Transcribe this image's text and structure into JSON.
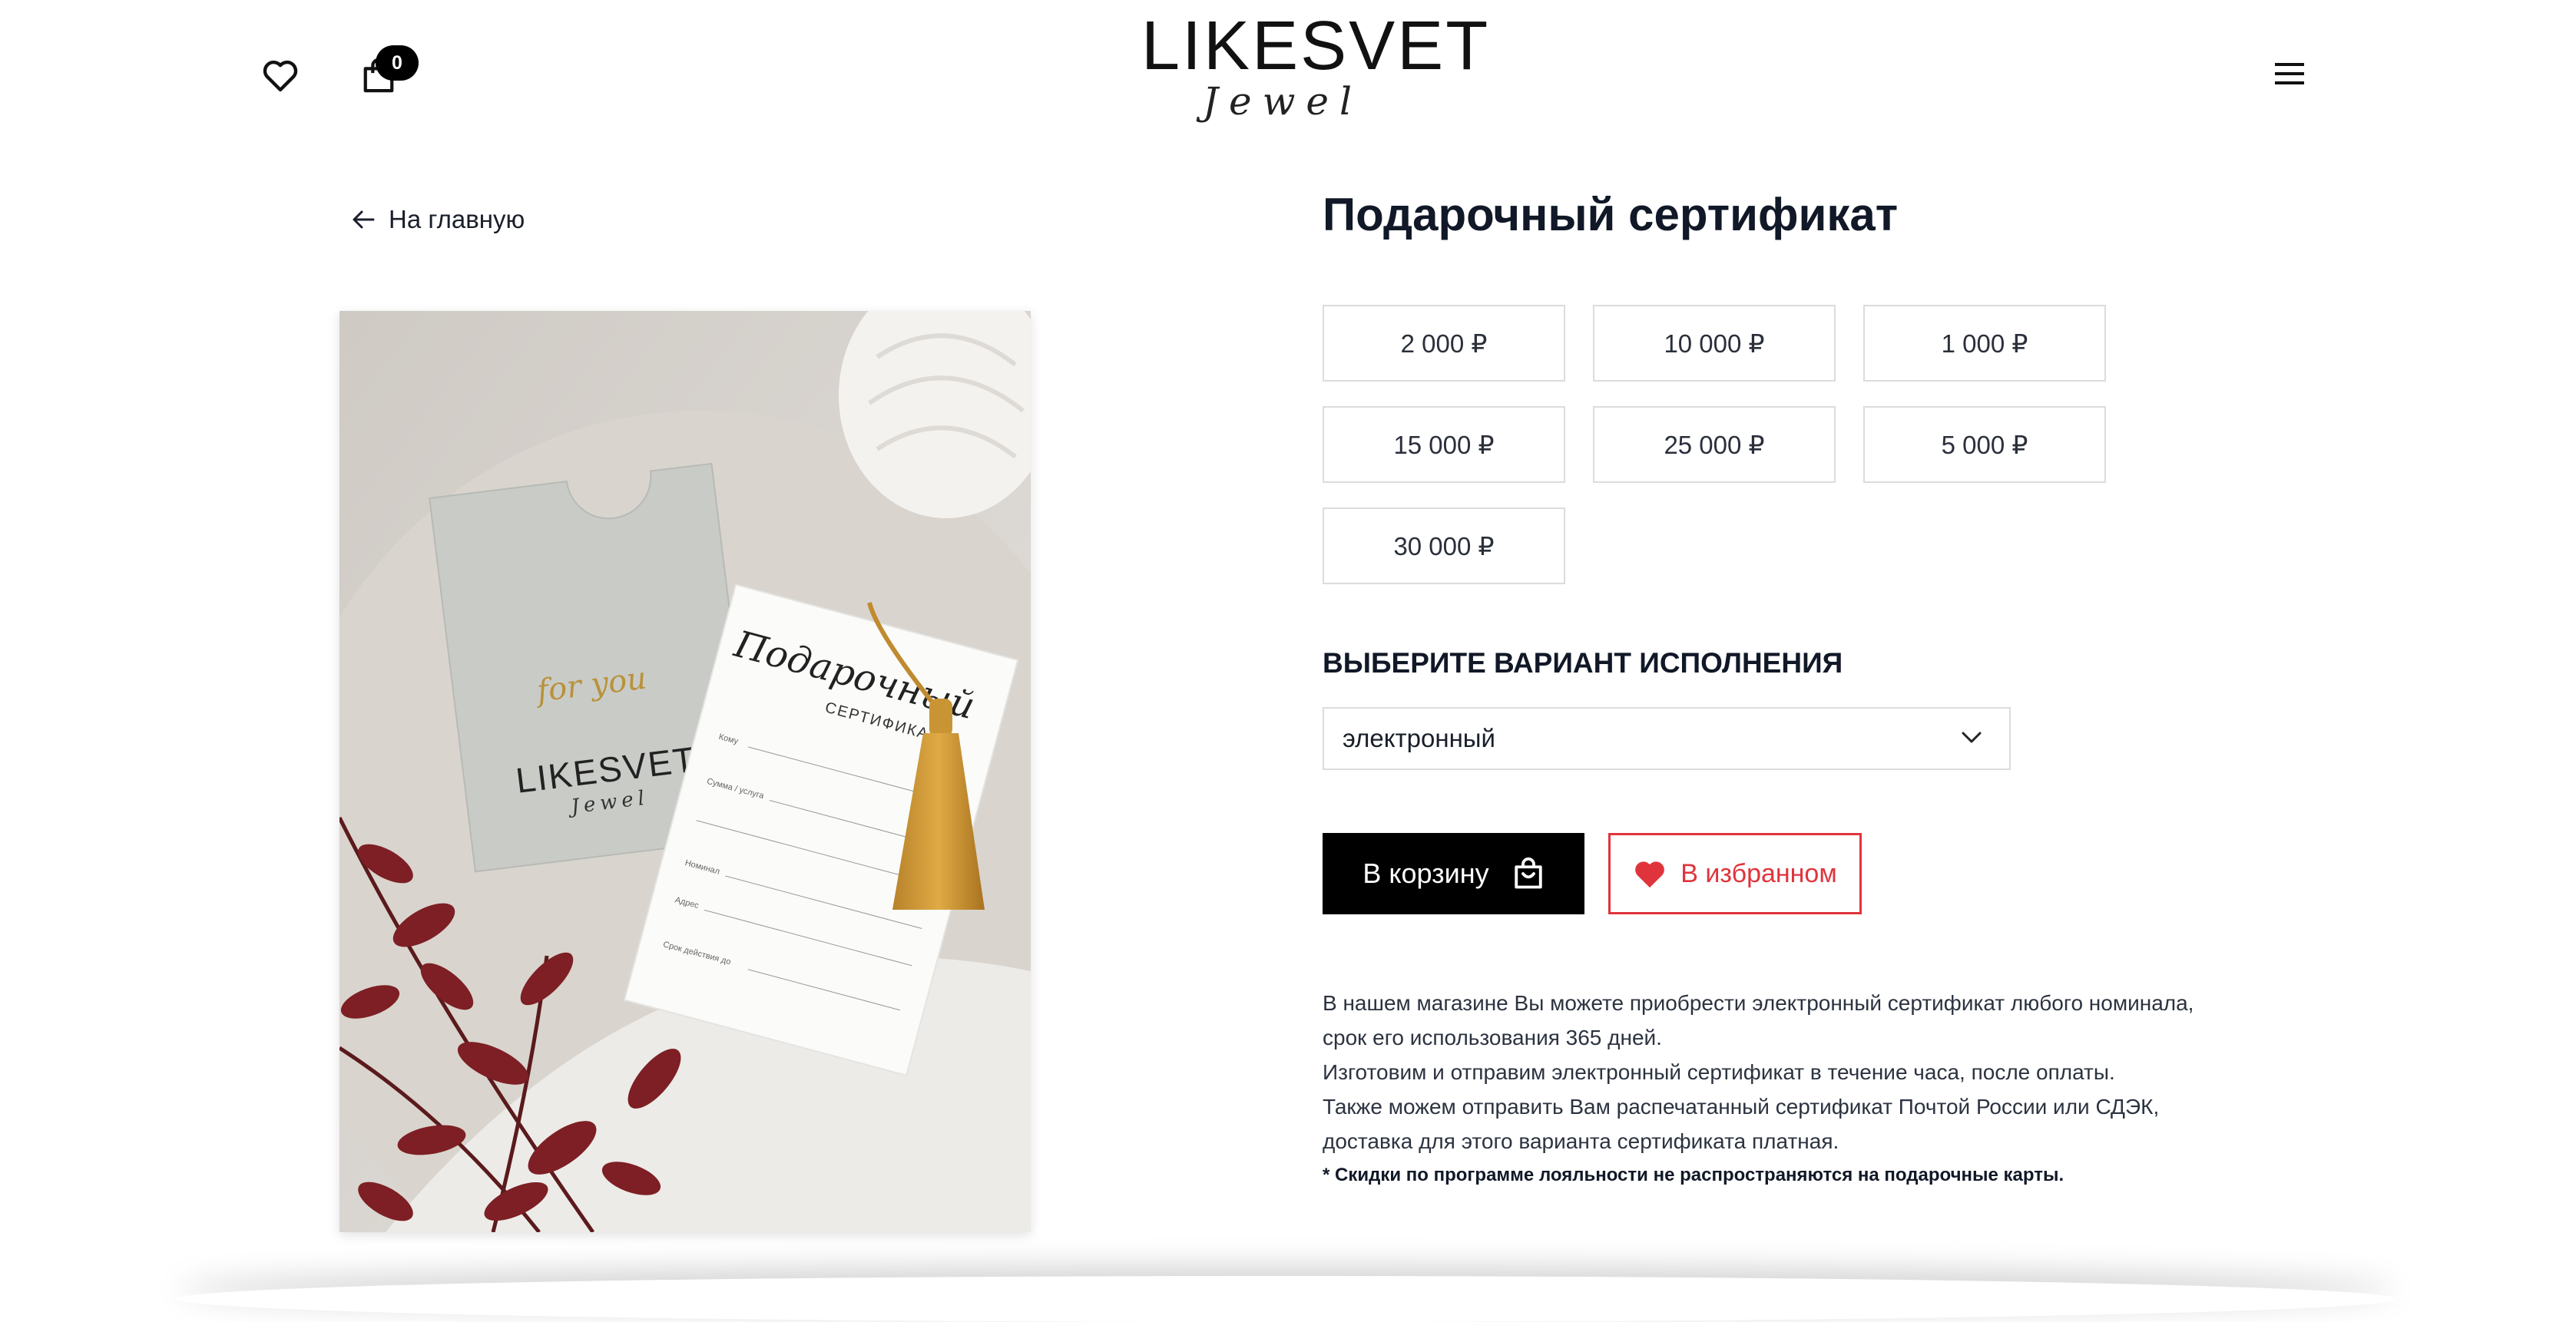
{
  "header": {
    "cart_count": "0",
    "logo_main": "LIKESVET",
    "logo_sub": "Jewel"
  },
  "nav": {
    "back_label": "На главную"
  },
  "product": {
    "title": "Подарочный сертификат",
    "amounts": [
      "2 000 ₽",
      "10 000 ₽",
      "1 000 ₽",
      "15 000 ₽",
      "25 000 ₽",
      "5 000 ₽",
      "30 000 ₽"
    ],
    "variant_label": "ВЫБЕРИТЕ ВАРИАНТ ИСПОЛНЕНИЯ",
    "variant_value": "электронный",
    "cart_button": "В корзину",
    "favorite_button": "В избранном",
    "description": [
      "В нашем магазине Вы можете приобрести электронный сертификат любого номинала,",
      "срок его использования 365 дней.",
      "Изготовим и отправим электронный сертификат в течение часа, после оплаты.",
      "Также можем отправить Вам распечатанный сертификат Почтой России или СДЭК,",
      "доставка для этого варианта сертификата платная."
    ],
    "note": "* Скидки по программе лояльности не распространяются на подарочные карты."
  },
  "photo": {
    "envelope_script": "for you",
    "envelope_logo": "LIKESVET",
    "envelope_logo_sub": "Jewel",
    "card_script": "Подарочный",
    "card_title": "СЕРТИФИКАТ",
    "card_fields": [
      "Кому",
      "Сумма / услуга",
      "Номинал",
      "Адрес",
      "Срок действия до"
    ]
  },
  "colors": {
    "accent": "#e0343c",
    "dark": "#000000",
    "border": "#dcdcdc"
  }
}
